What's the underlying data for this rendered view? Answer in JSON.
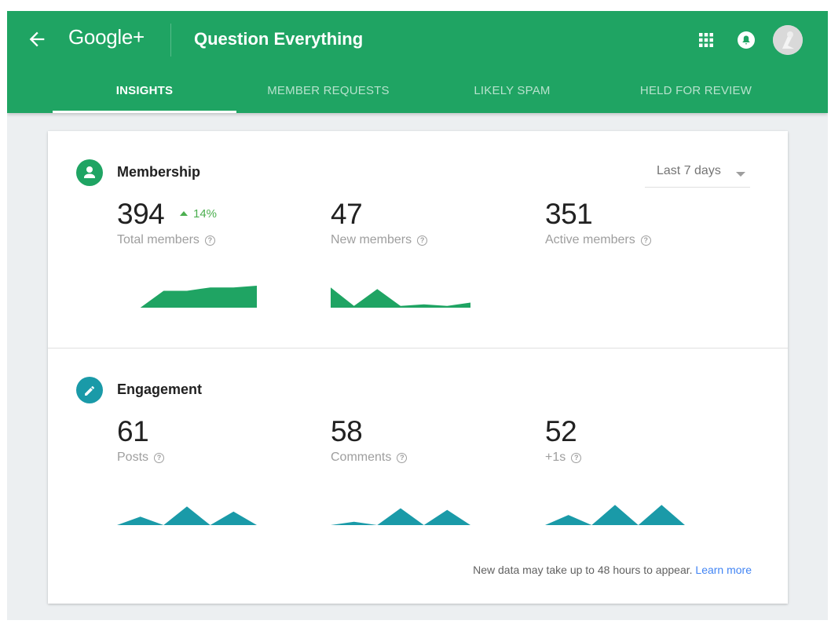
{
  "header": {
    "brand": "Google+",
    "community_title": "Question Everything",
    "colors": {
      "bar": "#1fa463",
      "membership_accent": "#1fa463",
      "engagement_accent": "#1a9aa8"
    }
  },
  "tabs": [
    {
      "label": "INSIGHTS",
      "active": true
    },
    {
      "label": "MEMBER REQUESTS",
      "active": false
    },
    {
      "label": "LIKELY SPAM",
      "active": false
    },
    {
      "label": "HELD FOR REVIEW",
      "active": false
    }
  ],
  "membership": {
    "title": "Membership",
    "icon": "person-icon",
    "range": "Last 7 days",
    "metrics": [
      {
        "value": "394",
        "change": "14%",
        "label": "Total members",
        "trend": [
          0,
          0,
          20,
          20,
          24,
          24,
          26
        ]
      },
      {
        "value": "47",
        "label": "New members",
        "trend": [
          24,
          2,
          22,
          2,
          4,
          2,
          6
        ]
      },
      {
        "value": "351",
        "label": "Active members",
        "trend": []
      }
    ]
  },
  "engagement": {
    "title": "Engagement",
    "icon": "pencil-icon",
    "metrics": [
      {
        "value": "61",
        "label": "Posts",
        "trend": [
          0,
          10,
          0,
          22,
          0,
          16,
          0
        ]
      },
      {
        "value": "58",
        "label": "Comments",
        "trend": [
          0,
          4,
          0,
          20,
          0,
          18,
          0
        ]
      },
      {
        "value": "52",
        "label": "+1s",
        "trend": [
          0,
          12,
          0,
          24,
          0,
          24,
          0
        ]
      }
    ]
  },
  "footer": {
    "note": "New data may take up to 48 hours to appear.",
    "link": "Learn more"
  }
}
